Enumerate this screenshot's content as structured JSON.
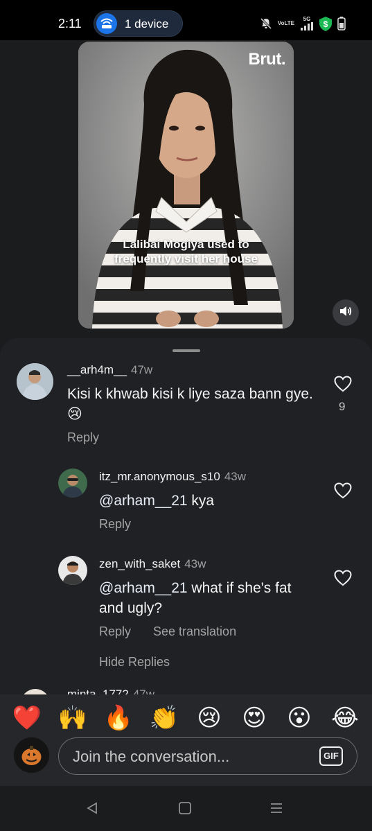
{
  "status_bar": {
    "time": "2:11",
    "device_label": "1 device",
    "volte_top": "Vo",
    "volte_bottom": "LTE",
    "network": "5G"
  },
  "video": {
    "brand": "Brut.",
    "caption_line1": "Lalibai Mogiya used to",
    "caption_line2": "frequently visit her house"
  },
  "comments": [
    {
      "username": "__arh4m__",
      "time": "47w",
      "text": "Kisi k khwab kisi k liye saza bann gye. 😢",
      "reply_label": "Reply",
      "likes": "9"
    },
    {
      "username": "itz_mr.anonymous_s10",
      "time": "43w",
      "mention": "@arham__21",
      "text": " kya",
      "reply_label": "Reply"
    },
    {
      "username": "zen_with_saket",
      "time": "43w",
      "mention": "@arham__21",
      "text": " what if she's fat and ugly?",
      "reply_label": "Reply",
      "translate_label": "See translation"
    }
  ],
  "hide_replies_label": "Hide Replies",
  "next_comment_partial": {
    "username": "minta_1772",
    "time": "47w"
  },
  "emoji_bar": [
    "❤️",
    "🙌",
    "🔥",
    "👏",
    "😢",
    "😍",
    "😮",
    "😂"
  ],
  "composer": {
    "placeholder": "Join the conversation...",
    "gif_label": "GIF"
  },
  "colors": {
    "background": "#202124",
    "accent_wifi": "#1b74e8",
    "shield_green": "#1db954"
  }
}
